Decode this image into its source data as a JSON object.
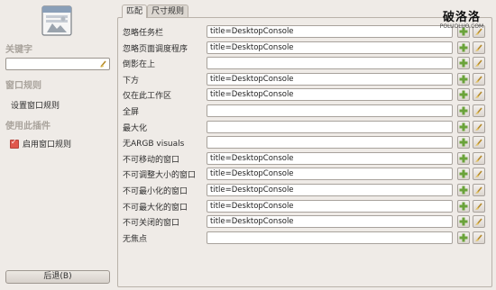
{
  "sidebar": {
    "icon": "window-rules-plugin-icon",
    "keyword_heading": "关键字",
    "search_value": "",
    "window_rules_heading": "窗口规则",
    "set_rules_link": "设置窗口规则",
    "use_plugin_heading": "使用此插件",
    "enable_label": "启用窗口规则",
    "enable_checked": true,
    "back_button": "后退(B)"
  },
  "tabs": [
    {
      "label": "匹配",
      "active": true
    },
    {
      "label": "尺寸规则",
      "active": false
    }
  ],
  "rows": [
    {
      "label": "忽略任务栏",
      "value": "title=DesktopConsole"
    },
    {
      "label": "忽略页面调度程序",
      "value": "title=DesktopConsole"
    },
    {
      "label": "倒影在上",
      "value": ""
    },
    {
      "label": "下方",
      "value": "title=DesktopConsole"
    },
    {
      "label": "仅在此工作区",
      "value": "title=DesktopConsole"
    },
    {
      "label": "全屏",
      "value": ""
    },
    {
      "label": "最大化",
      "value": ""
    },
    {
      "label": "无ARGB visuals",
      "value": ""
    },
    {
      "label": "不可移动的窗口",
      "value": "title=DesktopConsole"
    },
    {
      "label": "不可调整大小的窗口",
      "value": "title=DesktopConsole"
    },
    {
      "label": "不可最小化的窗口",
      "value": "title=DesktopConsole"
    },
    {
      "label": "不可最大化的窗口",
      "value": "title=DesktopConsole"
    },
    {
      "label": "不可关闭的窗口",
      "value": "title=DesktopConsole"
    },
    {
      "label": "无焦点",
      "value": ""
    }
  ],
  "watermark": {
    "title": "破洛洛",
    "url": "POLUOLUO.COM"
  },
  "colors": {
    "background": "#efebe7",
    "heading": "#a9a39c",
    "checkbox": "#e0574c",
    "add_icon": "#6aa33a"
  }
}
